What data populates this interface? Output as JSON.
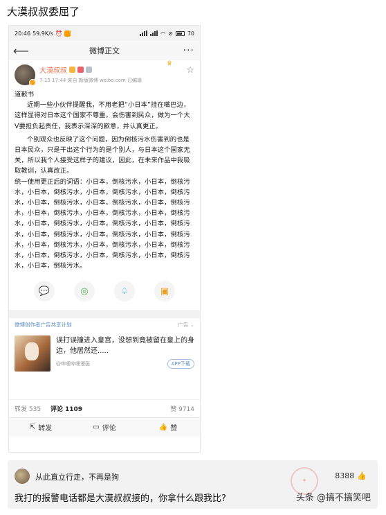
{
  "post_title": "大漠叔叔委屈了",
  "status_bar": {
    "time": "20:46",
    "speed": "59.9K/s",
    "battery": "70"
  },
  "nav": {
    "back_icon": "back-arrow-icon",
    "title": "微博正文",
    "more_icon": "more-dots-icon"
  },
  "author": {
    "name": "大漠叔叔",
    "meta": "7-15 17:44  来自 新版微博 weibo.com  已编辑"
  },
  "body": {
    "heading": "道歉书",
    "para1": "近期一些小伙伴提醒我，不用老把“小日本”挂在嘴巴边，这样显得对日本这个国家不尊重，会伤害到民众，做为一个大V要担负起责任，我表示深深的歉意，并认真更正。",
    "para2": "个别观众也反映了这个问题，因为倒核污水伤害到的也是日本民众，只是干出这个行为的是个别人，与日本这个国家无关，所以我个人接受这样子的建议，因此，在未来作品中我吸取教训，认真改正。",
    "para3": "统一使用更正后的词语：小日本，倒核污水，小日本，倒核污水，小日本，倒核污水，小日本，倒核污水，小日本，倒核污水，小日本，倒核污水，小日本，倒核污水，小日本，倒核污水，小日本，倒核污水，小日本，倒核污水，小日本，倒核污水，小日本，倒核污水，小日本，倒核污水，小日本，倒核污水，小日本，倒核污水，小日本，倒核污水，小日本，倒核污水，小日本，倒核污水，小日本，倒核污水，小日本，倒核污水，小日本，倒核污水，小日本，倒核污水，小日本，倒核污水，小日本，倒核污水。"
  },
  "share_icons": [
    "wechat-icon",
    "moments-icon",
    "qq-icon",
    "save-icon"
  ],
  "ad": {
    "label": "微博创作者广告共享计划",
    "tag": "广告",
    "text": "误打误撞进入皇宫，没想到竟被留在皇上的身边，他居然还.....",
    "source": "@哔哩哔哩漫画",
    "download": "APP下载"
  },
  "stats": {
    "repost": "转发 535",
    "comment_label": "评论",
    "comment_count": "1109",
    "like": "赞 9714"
  },
  "actions": {
    "repost": "转发",
    "comment": "评论",
    "like": "赞"
  },
  "comment": {
    "user": "从此直立行走，不再是狗",
    "likes": "8388",
    "text": "我打的报警电话都是大漠叔叔接的，你拿什么跟我比?"
  },
  "watermark": "头条 @搞不搞笑吧"
}
